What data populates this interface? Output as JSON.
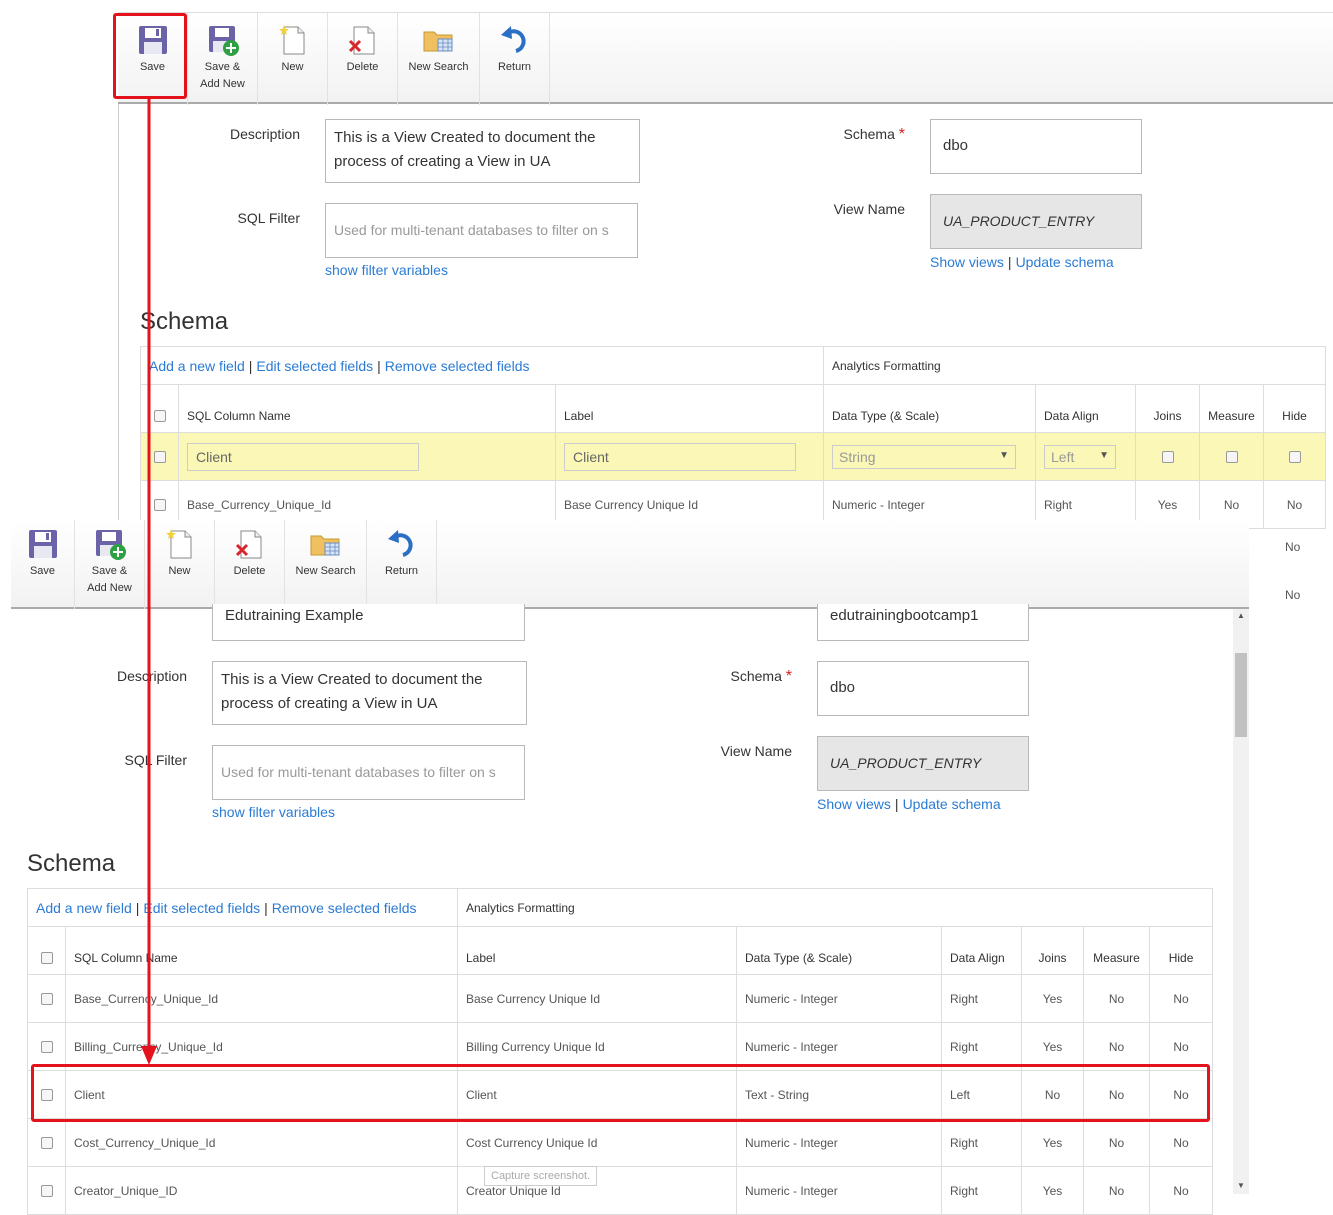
{
  "toolbar": {
    "save": "Save",
    "save_add_line1": "Save &",
    "save_add_line2": "Add New",
    "new": "New",
    "delete": "Delete",
    "new_search": "New Search",
    "return": "Return"
  },
  "form": {
    "description_label": "Description",
    "description_line1": "This is a View Created to document the",
    "description_line2": "process of creating a View in UA",
    "sql_filter_label": "SQL Filter",
    "sql_filter_placeholder": "Used for multi-tenant databases to filter on s",
    "show_filter_variables": "show filter variables",
    "schema_label": "Schema",
    "schema_value": "dbo",
    "view_name_label": "View Name",
    "view_name_value": "UA_PRODUCT_ENTRY",
    "show_views": "Show views",
    "update_schema": "Update schema",
    "name_value": "Edutraining Example",
    "database_value": "edutrainingbootcamp1"
  },
  "schema": {
    "title": "Schema",
    "add_field": "Add a new field",
    "edit_fields": "Edit selected fields",
    "remove_fields": "Remove selected fields",
    "analytics_formatting": "Analytics Formatting",
    "columns": [
      "SQL Column Name",
      "Label",
      "Data Type (& Scale)",
      "Data Align",
      "Joins",
      "Measure",
      "Hide"
    ]
  },
  "top_table": {
    "edit_row": {
      "sql": "Client",
      "label": "Client",
      "type": "String",
      "align": "Left"
    },
    "rows": [
      {
        "sql": "Base_Currency_Unique_Id",
        "label": "Base Currency Unique Id",
        "type": "Numeric - Integer",
        "align": "Right",
        "joins": "Yes",
        "measure": "No",
        "hide": "No"
      }
    ],
    "extra_hide": [
      "No",
      "No"
    ]
  },
  "bottom_table": {
    "rows": [
      {
        "sql": "Base_Currency_Unique_Id",
        "label": "Base Currency Unique Id",
        "type": "Numeric - Integer",
        "align": "Right",
        "joins": "Yes",
        "measure": "No",
        "hide": "No"
      },
      {
        "sql": "Billing_Currency_Unique_Id",
        "label": "Billing Currency Unique Id",
        "type": "Numeric - Integer",
        "align": "Right",
        "joins": "Yes",
        "measure": "No",
        "hide": "No"
      },
      {
        "sql": "Client",
        "label": "Client",
        "type": "Text - String",
        "align": "Left",
        "joins": "No",
        "measure": "No",
        "hide": "No"
      },
      {
        "sql": "Cost_Currency_Unique_Id",
        "label": "Cost Currency Unique Id",
        "type": "Numeric - Integer",
        "align": "Right",
        "joins": "Yes",
        "measure": "No",
        "hide": "No"
      },
      {
        "sql": "Creator_Unique_ID",
        "label": "Creator Unique Id",
        "type": "Numeric - Integer",
        "align": "Right",
        "joins": "Yes",
        "measure": "No",
        "hide": "No"
      }
    ]
  },
  "tooltip": "Capture screenshot.",
  "colors": {
    "highlight": "#e3121c",
    "link": "#2a7bd4",
    "edit_row": "#fbf8b7"
  }
}
